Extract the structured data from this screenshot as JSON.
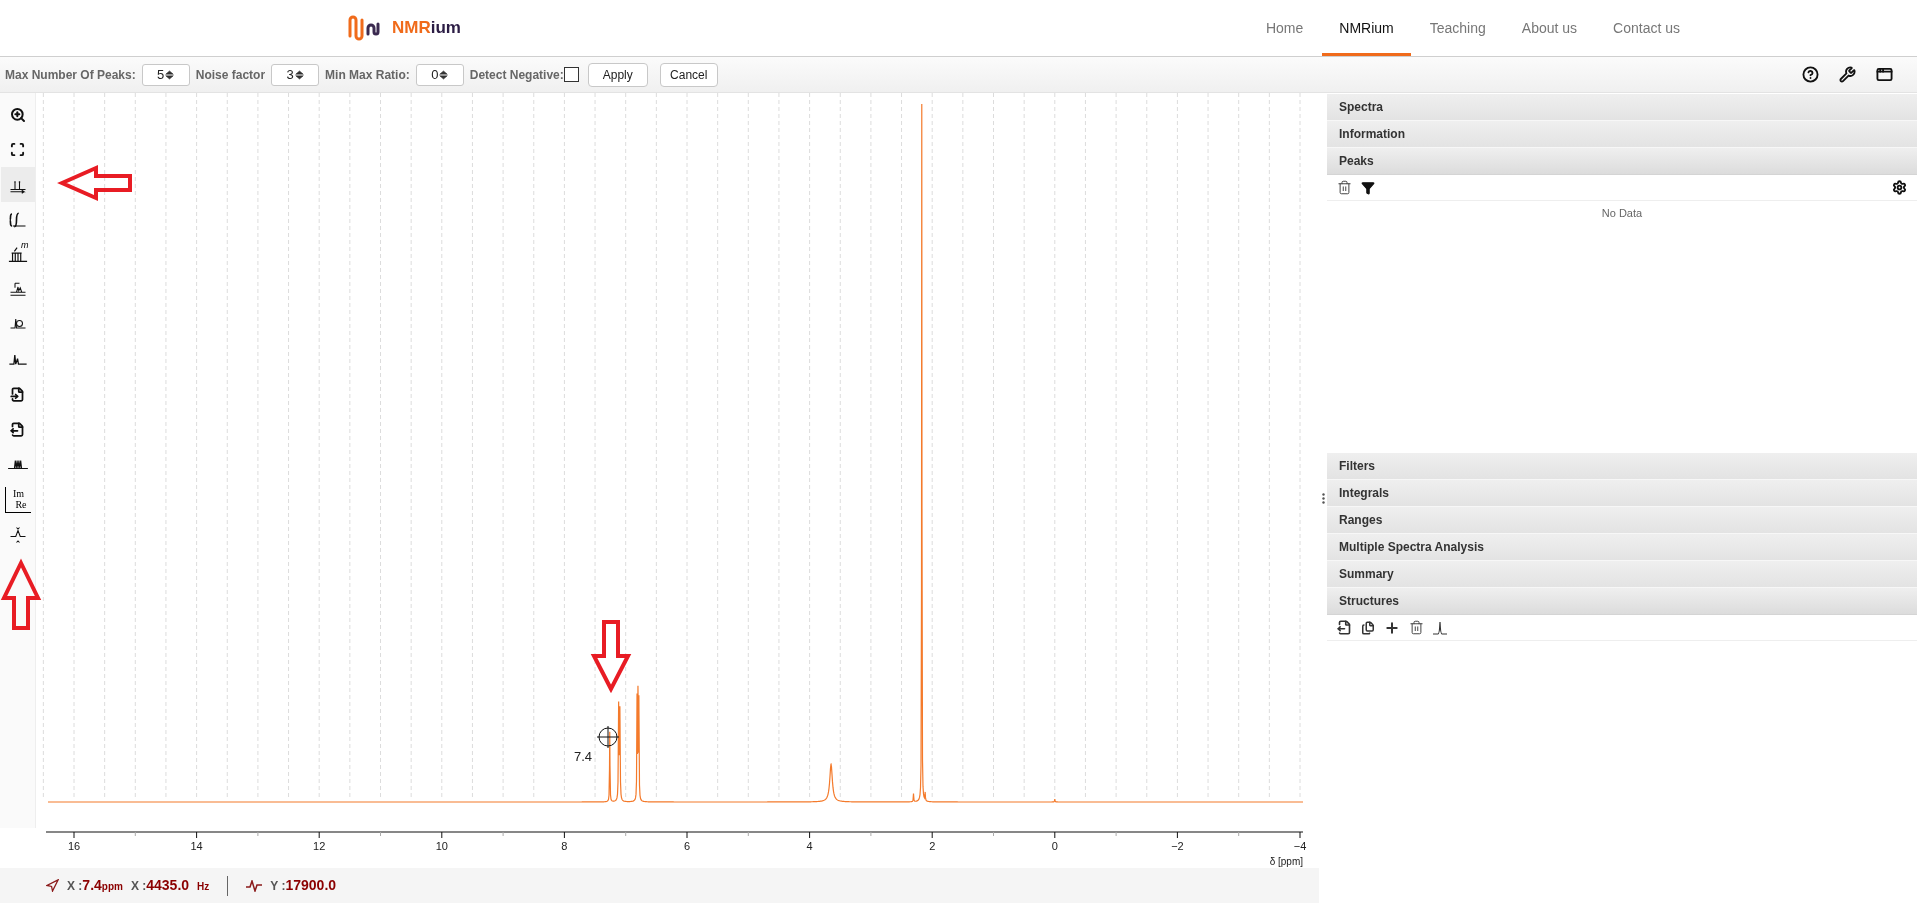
{
  "header": {
    "logo": {
      "text_primary": "NMR",
      "text_secondary": "ium"
    },
    "nav": [
      {
        "label": "Home",
        "selected": false
      },
      {
        "label": "NMRium",
        "selected": true
      },
      {
        "label": "Teaching",
        "selected": false
      },
      {
        "label": "About us",
        "selected": false
      },
      {
        "label": "Contact us",
        "selected": false
      }
    ]
  },
  "peak_options": {
    "fields": [
      {
        "label": "Max Number Of Peaks:",
        "value": "5"
      },
      {
        "label": "Noise factor",
        "value": "3"
      },
      {
        "label": "Min Max Ratio:",
        "value": "0"
      }
    ],
    "detect_negative": {
      "label": "Detect Negative:",
      "checked": false
    },
    "buttons": [
      "Apply",
      "Cancel"
    ]
  },
  "tools": [
    {
      "kind": "zoom",
      "selected": false
    },
    {
      "kind": "fit",
      "selected": false
    },
    {
      "kind": "peaks",
      "selected": true
    },
    {
      "kind": "integral",
      "selected": false
    },
    {
      "kind": "multiplet",
      "selected": false,
      "letter": "m"
    },
    {
      "kind": "baseline",
      "selected": false
    },
    {
      "kind": "phase",
      "selected": false
    },
    {
      "kind": "spectrum",
      "selected": false
    },
    {
      "kind": "import",
      "selected": false
    },
    {
      "kind": "export",
      "selected": false
    },
    {
      "kind": "multi_peaks",
      "selected": false
    },
    {
      "kind": "im_re",
      "selected": false,
      "top": "Im",
      "bottom": "Re"
    },
    {
      "kind": "flip",
      "selected": false
    }
  ],
  "chart": {
    "x_axis": {
      "ticks": [
        "16",
        "14",
        "12",
        "10",
        "8",
        "6",
        "4",
        "2",
        "0",
        "−2",
        "−4"
      ],
      "label": "δ [ppm]"
    },
    "cursor_label": "7.4"
  },
  "panels": [
    {
      "title": "Spectra",
      "expanded": false
    },
    {
      "title": "Information",
      "expanded": false
    },
    {
      "title": "Peaks",
      "expanded": true,
      "kind": "peaks",
      "empty_message": "No Data"
    },
    {
      "title": "Filters",
      "expanded": false
    },
    {
      "title": "Integrals",
      "expanded": false
    },
    {
      "title": "Ranges",
      "expanded": false
    },
    {
      "title": "Multiple Spectra Analysis",
      "expanded": false
    },
    {
      "title": "Summary",
      "expanded": false
    },
    {
      "title": "Structures",
      "expanded": true,
      "kind": "structures"
    }
  ],
  "status_bar": {
    "items": [
      {
        "label": "X :",
        "value": "7.4",
        "unit": "ppm"
      },
      {
        "label": "X :",
        "value": "4435.0",
        "unit": "Hz"
      },
      {
        "label": "Y :",
        "value": "17900.0"
      }
    ]
  }
}
